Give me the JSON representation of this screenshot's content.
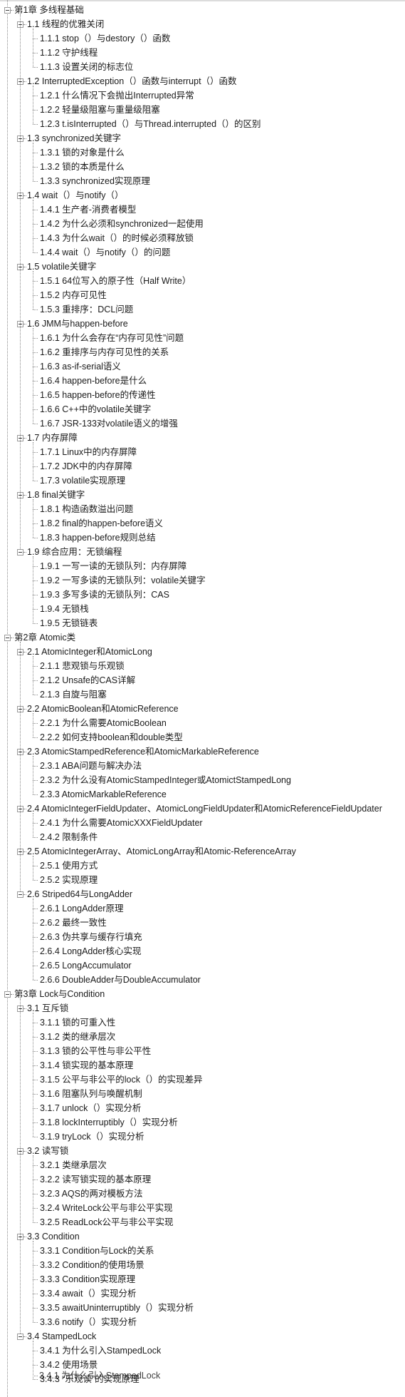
{
  "tree": [
    {
      "label": "第1章 多线程基础",
      "children": [
        {
          "label": "1.1 线程的优雅关闭",
          "children": [
            "1.1.1 stop（）与destory（）函数",
            "1.1.2 守护线程",
            "1.1.3 设置关闭的标志位"
          ]
        },
        {
          "label": "1.2 InterruptedException（）函数与interrupt（）函数",
          "children": [
            "1.2.1 什么情况下会抛出Interrupted异常",
            "1.2.2 轻量级阻塞与重量级阻塞",
            "1.2.3 t.isInterrupted（）与Thread.interrupted（）的区别"
          ]
        },
        {
          "label": "1.3 synchronized关键字",
          "children": [
            "1.3.1 锁的对象是什么",
            "1.3.2 锁的本质是什么",
            "1.3.3 synchronized实现原理"
          ]
        },
        {
          "label": "1.4 wait（）与notify（）",
          "children": [
            "1.4.1 生产者-消费者模型",
            "1.4.2 为什么必须和synchronized一起使用",
            "1.4.3 为什么wait（）的时候必须释放锁",
            "1.4.4 wait（）与notify（）的问题"
          ]
        },
        {
          "label": "1.5 volatile关键字",
          "children": [
            "1.5.1 64位写入的原子性（Half Write）",
            "1.5.2 内存可见性",
            "1.5.3 重排序：DCL问题"
          ]
        },
        {
          "label": "1.6 JMM与happen-before",
          "children": [
            "1.6.1 为什么会存在“内存可见性”问题",
            "1.6.2 重排序与内存可见性的关系",
            "1.6.3 as-if-serial语义",
            "1.6.4 happen-before是什么",
            "1.6.5 happen-before的传递性",
            "1.6.6 C++中的volatile关键字",
            "1.6.7 JSR-133对volatile语义的增强"
          ]
        },
        {
          "label": "1.7 内存屏障",
          "children": [
            "1.7.1 Linux中的内存屏障",
            "1.7.2 JDK中的内存屏障",
            "1.7.3 volatile实现原理"
          ]
        },
        {
          "label": "1.8 final关键字",
          "children": [
            "1.8.1 构造函数溢出问题",
            "1.8.2 final的happen-before语义",
            "1.8.3 happen-before规则总结"
          ]
        },
        {
          "label": "1.9 综合应用：无锁编程",
          "children": [
            "1.9.1 一写一读的无锁队列：内存屏障",
            "1.9.2 一写多读的无锁队列：volatile关键字",
            "1.9.3 多写多读的无锁队列：CAS",
            "1.9.4 无锁栈",
            "1.9.5 无锁链表"
          ]
        }
      ]
    },
    {
      "label": "第2章 Atomic类",
      "children": [
        {
          "label": "2.1 AtomicInteger和AtomicLong",
          "children": [
            "2.1.1 悲观锁与乐观锁",
            "2.1.2 Unsafe的CAS详解",
            "2.1.3 自旋与阻塞"
          ]
        },
        {
          "label": "2.2 AtomicBoolean和AtomicReference",
          "children": [
            "2.2.1 为什么需要AtomicBoolean",
            "2.2.2 如何支持boolean和double类型"
          ]
        },
        {
          "label": "2.3 AtomicStampedReference和AtomicMarkableReference",
          "children": [
            "2.3.1 ABA问题与解决办法",
            "2.3.2 为什么没有AtomicStampedInteger或AtomictStampedLong",
            "2.3.3 AtomicMarkableReference"
          ]
        },
        {
          "label": "2.4 AtomicIntegerFieldUpdater、AtomicLongFieldUpdater和AtomicReferenceFieldUpdater",
          "children": [
            "2.4.1 为什么需要AtomicXXXFieldUpdater",
            "2.4.2 限制条件"
          ]
        },
        {
          "label": "2.5 AtomicIntegerArray、AtomicLongArray和Atomic-ReferenceArray",
          "children": [
            "2.5.1 使用方式",
            "2.5.2 实现原理"
          ]
        },
        {
          "label": "2.6 Striped64与LongAdder",
          "children": [
            "2.6.1 LongAdder原理",
            "2.6.2 最终一致性",
            "2.6.3 伪共享与缓存行填充",
            "2.6.4 LongAdder核心实现",
            "2.6.5 LongAccumulator",
            "2.6.6 DoubleAdder与DoubleAccumulator"
          ]
        }
      ]
    },
    {
      "label": "第3章 Lock与Condition",
      "children": [
        {
          "label": "3.1 互斥锁",
          "children": [
            "3.1.1 锁的可重入性",
            "3.1.2 类的继承层次",
            "3.1.3 锁的公平性与非公平性",
            "3.1.4 锁实现的基本原理",
            "3.1.5 公平与非公平的lock（）的实现差异",
            "3.1.6 阻塞队列与唤醒机制",
            "3.1.7 unlock（）实现分析",
            "3.1.8 lockInterruptibly（）实现分析",
            "3.1.9 tryLock（）实现分析"
          ]
        },
        {
          "label": "3.2 读写锁",
          "children": [
            "3.2.1 类继承层次",
            "3.2.2 读写锁实现的基本原理",
            "3.2.3 AQS的两对模板方法",
            "3.2.4 WriteLock公平与非公平实现",
            "3.2.5 ReadLock公平与非公平实现"
          ]
        },
        {
          "label": "3.3 Condition",
          "children": [
            "3.3.1 Condition与Lock的关系",
            "3.3.2 Condition的使用场景",
            "3.3.3 Condition实现原理",
            "3.3.4 await（）实现分析",
            "3.3.5 awaitUninterruptibly（）实现分析",
            "3.3.6 notify（）实现分析"
          ]
        },
        {
          "label": "3.4 StampedLock",
          "children": [
            "3.4.1 为什么引入StampedLock",
            "3.4.2 使用场景",
            "3.4.3 “乐观读”的实现原理"
          ]
        }
      ]
    }
  ],
  "glitch_row": {
    "label": "3.4.1 为什么引入StampedLock"
  }
}
